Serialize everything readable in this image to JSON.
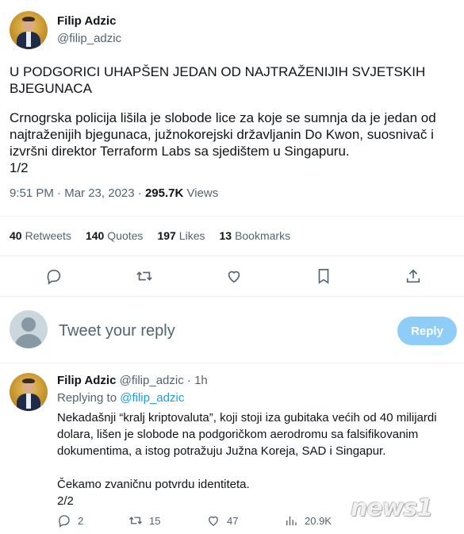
{
  "tweet": {
    "author_name": "Filip Adzic",
    "author_handle": "@filip_adzic",
    "headline": "U PODGORICI UHAPŠEN JEDAN OD NAJTRAŽENIJIH SVJETSKIH BJEGUNACA",
    "body": "Crnogrska policija lišila je slobode lice za koje se sumnja da je jedan od najtraženijih bjegunaca, južnokorejski državljanin Do Kwon, suosnivač i izvršni direktor Terraform Labs sa sjedištem u Singapuru.\n1/2",
    "time": "9:51 PM",
    "date": "Mar 23, 2023",
    "views_count": "295.7K",
    "views_label": "Views",
    "retweets_count": "40",
    "retweets_label": "Retweets",
    "quotes_count": "140",
    "quotes_label": "Quotes",
    "likes_count": "197",
    "likes_label": "Likes",
    "bookmarks_count": "13",
    "bookmarks_label": "Bookmarks"
  },
  "reply_box": {
    "placeholder": "Tweet your reply",
    "button_label": "Reply",
    "button_color": "#8ecdf8"
  },
  "reply": {
    "author_name": "Filip Adzic",
    "author_handle": "@filip_adzic",
    "time_ago": "1h",
    "replying_to_label": "Replying to",
    "replying_to_handle": "@filip_adzic",
    "body": "Nekadašnji “kralj kriptovaluta”, koji stoji iza gubitaka većih od 40 milijardi dolara, lišen je slobode na podgoričkom aerodromu sa falsifikovanim dokumentima, a istog potražuju Južna Koreja, SAD i Singapur.\n\nČekamo zvaničnu potvrdu identiteta.\n2/2",
    "replies": "2",
    "retweets": "15",
    "likes": "47",
    "views": "20.9K"
  },
  "watermark": "news1",
  "colors": {
    "link": "#1d9bf0",
    "secondary_text": "#536471",
    "primary_text": "#0f1419"
  }
}
